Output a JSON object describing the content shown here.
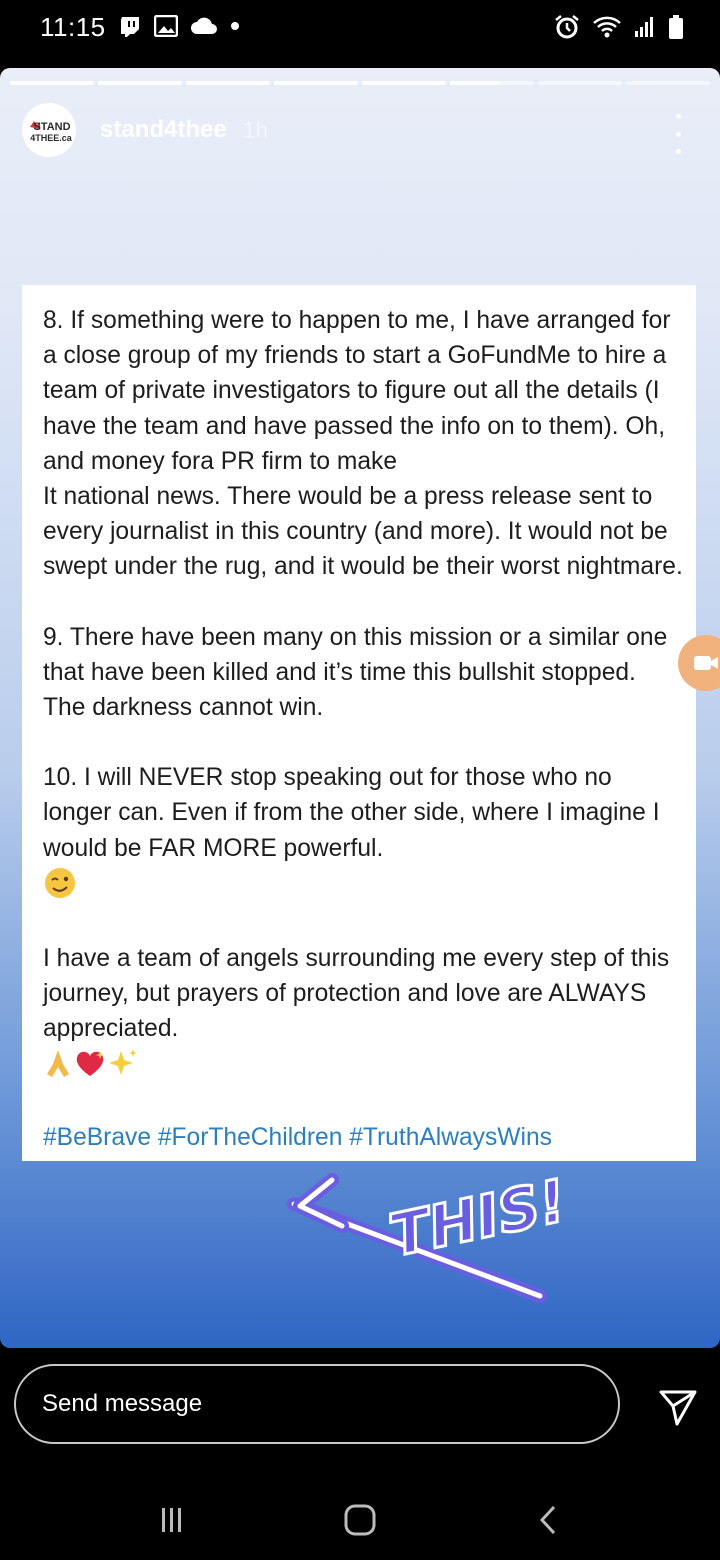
{
  "status_bar": {
    "time": "11:15"
  },
  "story": {
    "progress": [
      1,
      1,
      1,
      1,
      1,
      0.6,
      0,
      0
    ],
    "username": "stand4thee",
    "time_ago": "1h",
    "avatar_text_line1": "STAND",
    "avatar_text_line2": "4THEE.ca"
  },
  "post": {
    "paragraphs": [
      "8. If something were to happen to me, I have arranged for a close group of my friends to start a GoFundMe to hire a team of private investigators to figure out all the details (I have the team and have passed the info on to them). Oh, and money fora PR firm to make\nIt national news. There would be a press release sent to every journalist in this country (and more). It would not be swept under the rug, and it would be their worst nightmare.",
      "9. There have been many on this mission or a similar one that have been killed and it’s time this bullshit stopped. The darkness cannot win.",
      "10. I will NEVER stop speaking out for those who no longer can. Even if from the other side, where I imagine I would be FAR MORE powerful.",
      "I have a team of angels surrounding me every step of this journey, but prayers of protection and love are ALWAYS appreciated."
    ],
    "hashtags": "#BeBrave #ForTheChildren #TruthAlwaysWins"
  },
  "sticker": {
    "text": "THIS!"
  },
  "message_bar": {
    "placeholder": "Send message"
  },
  "colors": {
    "hashtag": "#2c7fbf",
    "sticker": "#6a5ee0",
    "camera": "#f2b27e"
  }
}
